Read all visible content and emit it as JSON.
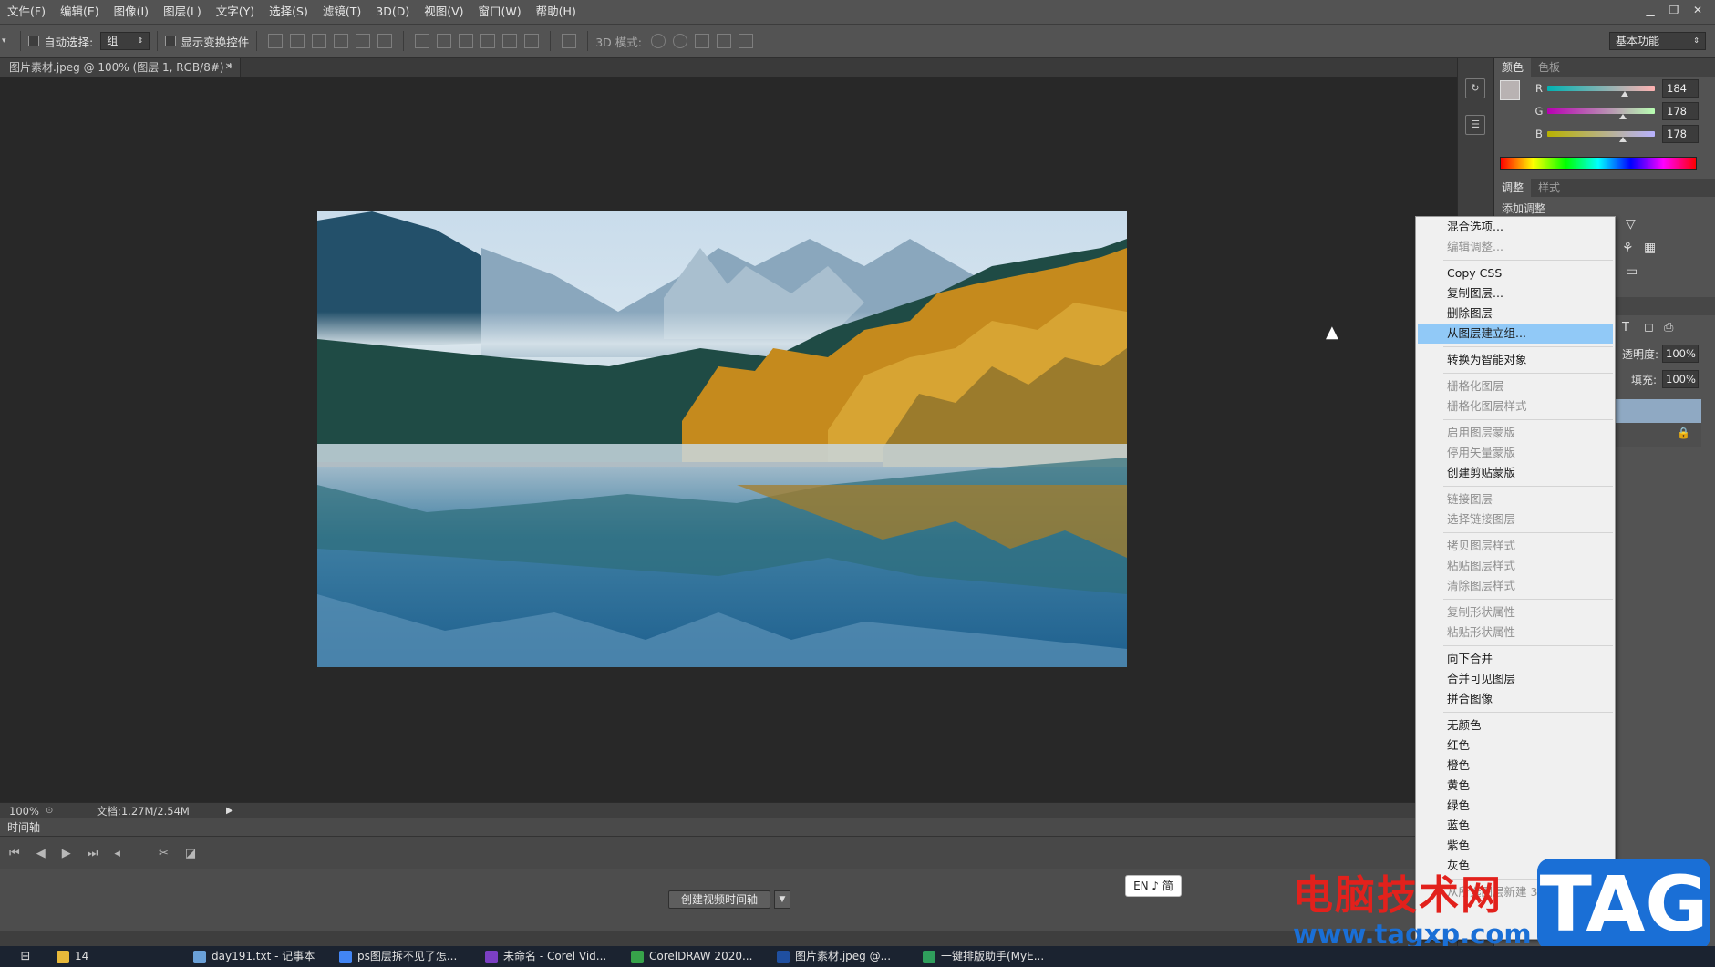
{
  "menu": [
    "文件(F)",
    "编辑(E)",
    "图像(I)",
    "图层(L)",
    "文字(Y)",
    "选择(S)",
    "滤镜(T)",
    "3D(D)",
    "视图(V)",
    "窗口(W)",
    "帮助(H)"
  ],
  "options": {
    "auto_select": "自动选择:",
    "auto_select_value": "组",
    "show_transform": "显示变换控件",
    "mode_3d": "3D 模式:",
    "workspace": "基本功能"
  },
  "doc": {
    "tab_title": "图片素材.jpeg @ 100% (图层 1, RGB/8#) *"
  },
  "status": {
    "zoom": "100%",
    "doc_size": "文档:1.27M/2.54M"
  },
  "timeline": {
    "title": "时间轴",
    "create_btn": "创建视频时间轴"
  },
  "ime": "EN ♪ 简",
  "color_panel": {
    "tabs": [
      "颜色",
      "色板"
    ],
    "channels": [
      {
        "name": "R",
        "value": "184",
        "fill": 0.72
      },
      {
        "name": "G",
        "value": "178",
        "fill": 0.7
      },
      {
        "name": "B",
        "value": "178",
        "fill": 0.7
      }
    ]
  },
  "adjust_panel": {
    "tabs": [
      "调整",
      "样式"
    ],
    "subtitle": "添加调整"
  },
  "layers_panel": {
    "opacity_label": "透明度:",
    "opacity": "100%",
    "fill_label": "填充:",
    "fill": "100%"
  },
  "context_menu": {
    "items": [
      {
        "label": "混合选项...",
        "state": "enabled"
      },
      {
        "label": "编辑调整...",
        "state": "disabled"
      },
      {
        "sep": true
      },
      {
        "label": "Copy CSS",
        "state": "enabled"
      },
      {
        "label": "复制图层...",
        "state": "enabled"
      },
      {
        "label": "删除图层",
        "state": "enabled"
      },
      {
        "label": "从图层建立组...",
        "state": "highlighted"
      },
      {
        "sep": true
      },
      {
        "label": "转换为智能对象",
        "state": "enabled"
      },
      {
        "sep": true
      },
      {
        "label": "栅格化图层",
        "state": "disabled"
      },
      {
        "label": "栅格化图层样式",
        "state": "disabled"
      },
      {
        "sep": true
      },
      {
        "label": "启用图层蒙版",
        "state": "disabled"
      },
      {
        "label": "停用矢量蒙版",
        "state": "disabled"
      },
      {
        "label": "创建剪贴蒙版",
        "state": "enabled"
      },
      {
        "sep": true
      },
      {
        "label": "链接图层",
        "state": "disabled"
      },
      {
        "label": "选择链接图层",
        "state": "disabled"
      },
      {
        "sep": true
      },
      {
        "label": "拷贝图层样式",
        "state": "disabled"
      },
      {
        "label": "粘贴图层样式",
        "state": "disabled"
      },
      {
        "label": "清除图层样式",
        "state": "disabled"
      },
      {
        "sep": true
      },
      {
        "label": "复制形状属性",
        "state": "disabled"
      },
      {
        "label": "粘贴形状属性",
        "state": "disabled"
      },
      {
        "sep": true
      },
      {
        "label": "向下合并",
        "state": "enabled"
      },
      {
        "label": "合并可见图层",
        "state": "enabled"
      },
      {
        "label": "拼合图像",
        "state": "enabled"
      },
      {
        "sep": true
      },
      {
        "label": "无颜色",
        "state": "enabled"
      },
      {
        "label": "红色",
        "state": "enabled"
      },
      {
        "label": "橙色",
        "state": "enabled"
      },
      {
        "label": "黄色",
        "state": "enabled"
      },
      {
        "label": "绿色",
        "state": "enabled"
      },
      {
        "label": "蓝色",
        "state": "enabled"
      },
      {
        "label": "紫色",
        "state": "enabled"
      },
      {
        "label": "灰色",
        "state": "enabled"
      },
      {
        "sep": true
      },
      {
        "label": "从所选图层新建 3D 凸出",
        "state": "disabled"
      }
    ]
  },
  "taskbar": [
    {
      "label": "14",
      "color": "#e8b93a"
    },
    {
      "label": "day191.txt - 记事本",
      "color": "#6aa0d8"
    },
    {
      "label": "ps图层拆不见了怎...",
      "color": "#4285f4"
    },
    {
      "label": "未命名 - Corel Vid...",
      "color": "#7b3fc4"
    },
    {
      "label": "CorelDRAW 2020...",
      "color": "#37a34a"
    },
    {
      "label": "图片素材.jpeg @...",
      "color": "#1f4fa0"
    },
    {
      "label": "一键排版助手(MyE...",
      "color": "#2f9e5c"
    }
  ],
  "watermark": {
    "cn": "电脑技术网",
    "url": "www.tagxp.com",
    "tag": "TAG"
  }
}
